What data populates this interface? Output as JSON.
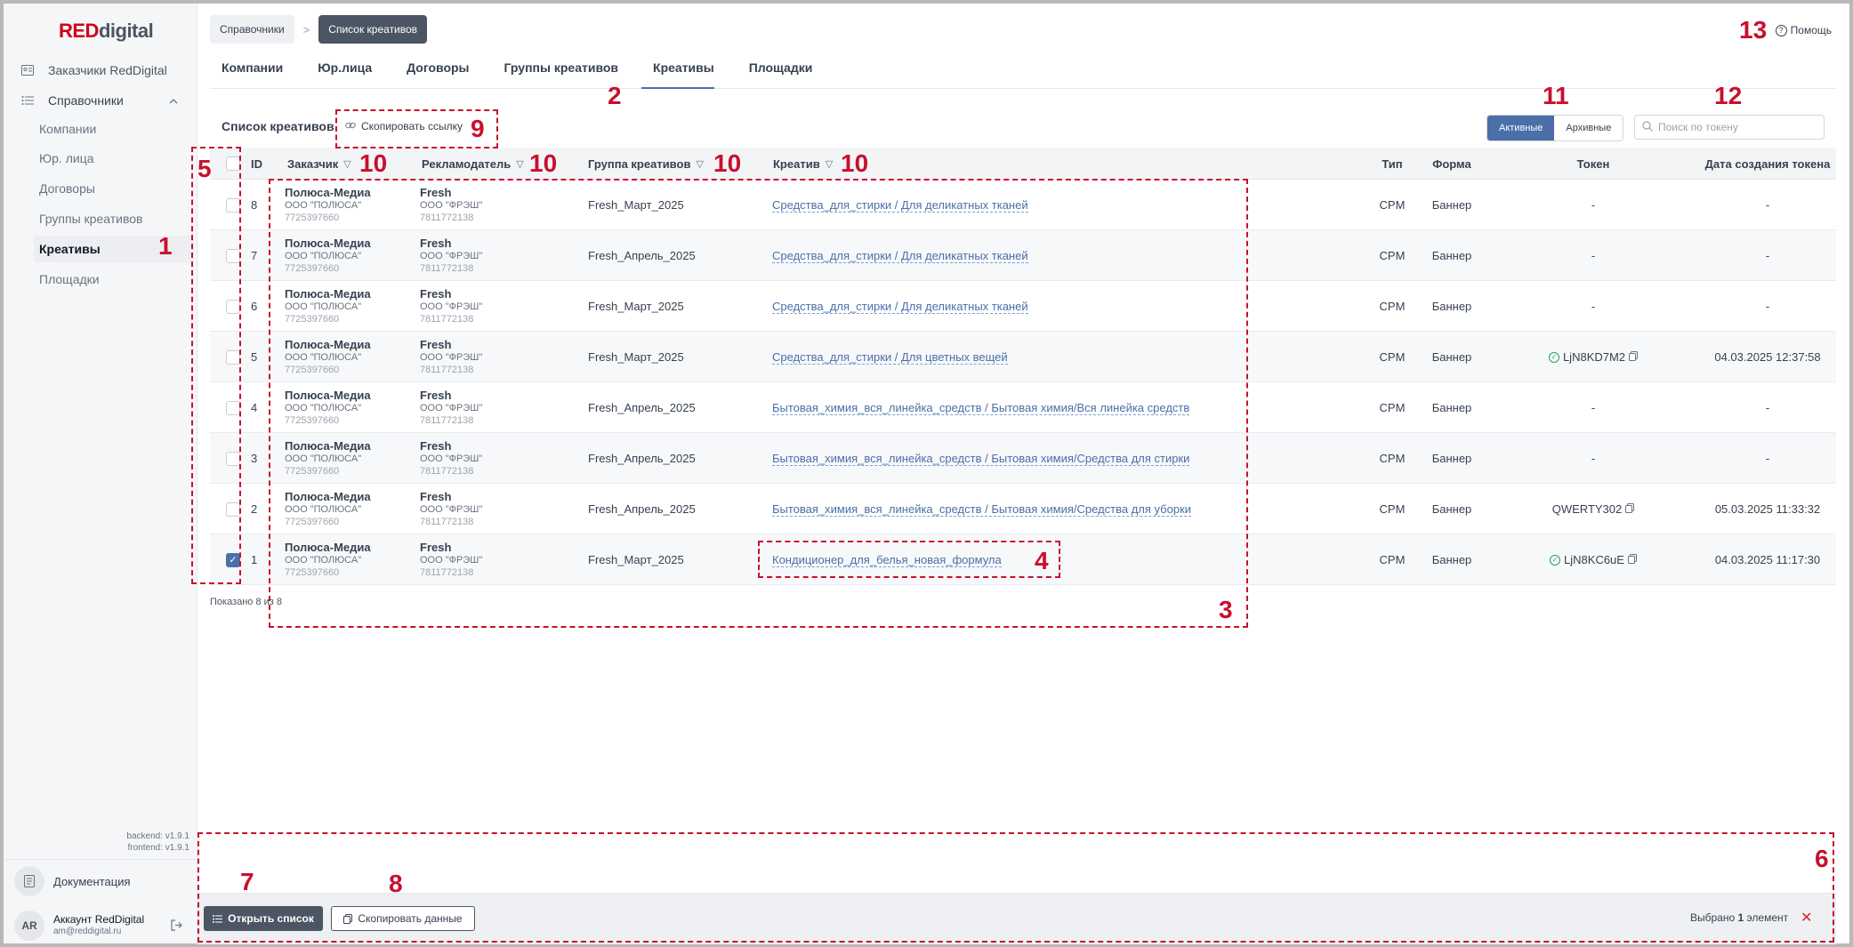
{
  "logo": {
    "red": "RED",
    "digital": "digital"
  },
  "sidebar": {
    "top_item": "Заказчики RedDigital",
    "section": "Справочники",
    "items": [
      {
        "label": "Компании"
      },
      {
        "label": "Юр. лица"
      },
      {
        "label": "Договоры"
      },
      {
        "label": "Группы креативов"
      },
      {
        "label": "Креативы"
      },
      {
        "label": "Площадки"
      }
    ],
    "active": "Креативы",
    "versions": {
      "backend": "backend: v1.9.1",
      "frontend": "frontend: v1.9.1"
    },
    "docs": "Документация",
    "account": {
      "initials": "AR",
      "name": "Аккаунт RedDigital",
      "email": "am@reddigital.ru"
    }
  },
  "breadcrumb": {
    "parent": "Справочники",
    "current": "Список креативов",
    "separator": ">"
  },
  "help": "Помощь",
  "tabs": [
    {
      "label": "Компании"
    },
    {
      "label": "Юр.лица"
    },
    {
      "label": "Договоры"
    },
    {
      "label": "Группы креативов"
    },
    {
      "label": "Креативы"
    },
    {
      "label": "Площадки"
    }
  ],
  "active_tab": "Креативы",
  "list": {
    "title": "Список креативов",
    "copy_link": "Скопировать ссылку",
    "toggle": {
      "active": "Активные",
      "archived": "Архивные"
    },
    "search_placeholder": "Поиск по токену"
  },
  "columns": {
    "id": "ID",
    "customer": "Заказчик",
    "advertiser": "Рекламодатель",
    "group": "Группа креативов",
    "creative": "Креатив",
    "type": "Тип",
    "form": "Форма",
    "token": "Токен",
    "token_date": "Дата создания токена"
  },
  "rows": [
    {
      "id": "8",
      "customer": "Полюса-Медиа",
      "customer_legal": "ООО \"ПОЛЮСА\"",
      "customer_inn": "7725397660",
      "advertiser": "Fresh",
      "advertiser_legal": "ООО \"ФРЭШ\"",
      "advertiser_inn": "7811772138",
      "group": "Fresh_Март_2025",
      "creative": "Средства_для_стирки / Для деликатных тканей",
      "type": "CPM",
      "form": "Баннер",
      "token": "-",
      "token_ok": false,
      "token_copy": false,
      "date": "-",
      "checked": false
    },
    {
      "id": "7",
      "customer": "Полюса-Медиа",
      "customer_legal": "ООО \"ПОЛЮСА\"",
      "customer_inn": "7725397660",
      "advertiser": "Fresh",
      "advertiser_legal": "ООО \"ФРЭШ\"",
      "advertiser_inn": "7811772138",
      "group": "Fresh_Апрель_2025",
      "creative": "Средства_для_стирки / Для деликатных тканей",
      "type": "CPM",
      "form": "Баннер",
      "token": "-",
      "token_ok": false,
      "token_copy": false,
      "date": "-",
      "checked": false
    },
    {
      "id": "6",
      "customer": "Полюса-Медиа",
      "customer_legal": "ООО \"ПОЛЮСА\"",
      "customer_inn": "7725397660",
      "advertiser": "Fresh",
      "advertiser_legal": "ООО \"ФРЭШ\"",
      "advertiser_inn": "7811772138",
      "group": "Fresh_Март_2025",
      "creative": "Средства_для_стирки / Для деликатных тканей",
      "type": "CPM",
      "form": "Баннер",
      "token": "-",
      "token_ok": false,
      "token_copy": false,
      "date": "-",
      "checked": false
    },
    {
      "id": "5",
      "customer": "Полюса-Медиа",
      "customer_legal": "ООО \"ПОЛЮСА\"",
      "customer_inn": "7725397660",
      "advertiser": "Fresh",
      "advertiser_legal": "ООО \"ФРЭШ\"",
      "advertiser_inn": "7811772138",
      "group": "Fresh_Март_2025",
      "creative": "Средства_для_стирки / Для цветных вещей",
      "type": "CPM",
      "form": "Баннер",
      "token": "LjN8KD7M2",
      "token_ok": true,
      "token_copy": true,
      "date": "04.03.2025 12:37:58",
      "checked": false
    },
    {
      "id": "4",
      "customer": "Полюса-Медиа",
      "customer_legal": "ООО \"ПОЛЮСА\"",
      "customer_inn": "7725397660",
      "advertiser": "Fresh",
      "advertiser_legal": "ООО \"ФРЭШ\"",
      "advertiser_inn": "7811772138",
      "group": "Fresh_Апрель_2025",
      "creative": "Бытовая_химия_вся_линейка_средств / Бытовая химия/Вся линейка средств",
      "type": "CPM",
      "form": "Баннер",
      "token": "-",
      "token_ok": false,
      "token_copy": false,
      "date": "-",
      "checked": false
    },
    {
      "id": "3",
      "customer": "Полюса-Медиа",
      "customer_legal": "ООО \"ПОЛЮСА\"",
      "customer_inn": "7725397660",
      "advertiser": "Fresh",
      "advertiser_legal": "ООО \"ФРЭШ\"",
      "advertiser_inn": "7811772138",
      "group": "Fresh_Апрель_2025",
      "creative": "Бытовая_химия_вся_линейка_средств / Бытовая химия/Средства для стирки",
      "type": "CPM",
      "form": "Баннер",
      "token": "-",
      "token_ok": false,
      "token_copy": false,
      "date": "-",
      "checked": false
    },
    {
      "id": "2",
      "customer": "Полюса-Медиа",
      "customer_legal": "ООО \"ПОЛЮСА\"",
      "customer_inn": "7725397660",
      "advertiser": "Fresh",
      "advertiser_legal": "ООО \"ФРЭШ\"",
      "advertiser_inn": "7811772138",
      "group": "Fresh_Апрель_2025",
      "creative": "Бытовая_химия_вся_линейка_средств / Бытовая химия/Средства для уборки",
      "type": "CPM",
      "form": "Баннер",
      "token": "QWERTY302",
      "token_ok": false,
      "token_copy": true,
      "date": "05.03.2025 11:33:32",
      "checked": false
    },
    {
      "id": "1",
      "customer": "Полюса-Медиа",
      "customer_legal": "ООО \"ПОЛЮСА\"",
      "customer_inn": "7725397660",
      "advertiser": "Fresh",
      "advertiser_legal": "ООО \"ФРЭШ\"",
      "advertiser_inn": "7811772138",
      "group": "Fresh_Март_2025",
      "creative": "Кондиционер_для_белья_новая_формула",
      "type": "CPM",
      "form": "Баннер",
      "token": "LjN8KC6uE",
      "token_ok": true,
      "token_copy": true,
      "date": "04.03.2025 11:17:30",
      "checked": true
    }
  ],
  "shown": "Показано 8 из 8",
  "bottom": {
    "open_list": "Открыть список",
    "copy_data": "Скопировать данные",
    "selected_prefix": "Выбрано",
    "selected_count": "1",
    "selected_suffix": "элемент",
    "close": "✕"
  },
  "annotations": [
    "1",
    "2",
    "3",
    "4",
    "5",
    "6",
    "7",
    "8",
    "9",
    "10",
    "10",
    "10",
    "10",
    "11",
    "12",
    "13"
  ],
  "colors": {
    "accent": "#4b6fa8",
    "brand_red": "#d0021b",
    "annotation": "#c8102e"
  }
}
